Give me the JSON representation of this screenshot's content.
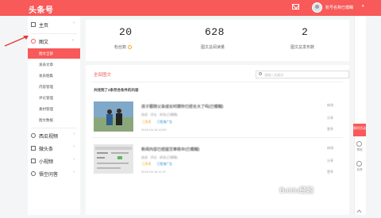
{
  "header": {
    "logo": "头条号",
    "user_name": "账号名称已模糊"
  },
  "sidebar": {
    "home": "主页",
    "article": "图文",
    "sub_items": [
      "图文全部",
      "发表文章",
      "发表图集",
      "内容管理",
      "评论管理",
      "素材管理",
      "图文数据"
    ],
    "more": [
      "西瓜视频",
      "微头条",
      "小视频",
      "悟空问答"
    ]
  },
  "stats": [
    {
      "value": "20",
      "label": "粉丝数"
    },
    {
      "value": "628",
      "label": "图文总阅读量"
    },
    {
      "value": "2",
      "label": "图文总发布数"
    }
  ],
  "list": {
    "tab": "全部图文",
    "search_placeholder": "请输入关键词",
    "found_text": "共找到了2条符合条件的内容",
    "articles": [
      {
        "title": "孩子跟随父亲成长时期你已经长大了吗(已模糊)",
        "meta": "阅读 · 评论 · 转发(已模糊)",
        "badge1": "已发表",
        "badge2": "已投放广告",
        "date": "2019-04-18 10:50",
        "actions": [
          "修改",
          "分享",
          "更多"
        ]
      },
      {
        "title": "新闻内容已经提交审核中(已模糊)",
        "meta": "阅读 · 评论 · 转发(已模糊)",
        "badge1": "已发表",
        "badge2": "已投放广告",
        "date": "2019-04-16 11:07",
        "actions": [
          "修改",
          "分享",
          "更多"
        ]
      }
    ]
  },
  "right_panel": {
    "promo": "限时活动",
    "labels": [
      "帮助",
      "反馈"
    ]
  },
  "watermark": "Baidu经验",
  "colors": {
    "accent": "#f85959",
    "badge_orange": "#f5a623",
    "badge_blue": "#2a90d7"
  }
}
